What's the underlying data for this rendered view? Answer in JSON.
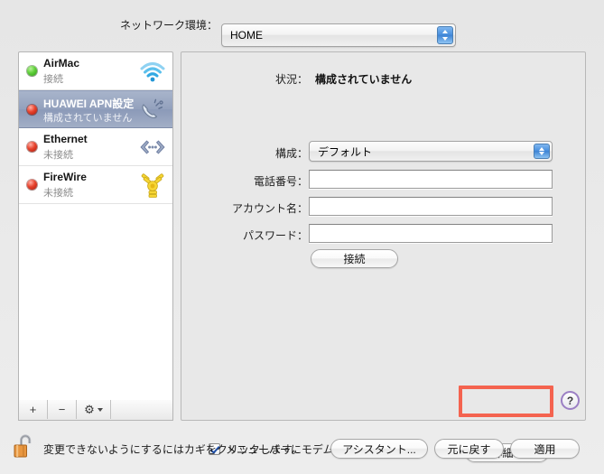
{
  "window": {
    "environment_label": "ネットワーク環境：",
    "environment_value": "HOME"
  },
  "sidebar": {
    "services": [
      {
        "name": "AirMac",
        "status": "接続",
        "icon": "wifi-icon",
        "led": "green",
        "selected": false
      },
      {
        "name": "HUAWEI APN設定",
        "status": "構成されていません",
        "icon": "modem-icon",
        "led": "red",
        "selected": true
      },
      {
        "name": "Ethernet",
        "status": "未接続",
        "icon": "ethernet-icon",
        "led": "red",
        "selected": false
      },
      {
        "name": "FireWire",
        "status": "未接続",
        "icon": "firewire-icon",
        "led": "red",
        "selected": false
      }
    ],
    "toolbar": {
      "add_label": "+",
      "remove_label": "−",
      "action_label": "⚙"
    }
  },
  "main": {
    "status_label": "状況：",
    "status_value": "構成されていません",
    "config_label": "構成：",
    "config_value": "デフォルト",
    "phone_label": "電話番号：",
    "phone_value": "",
    "account_label": "アカウント名：",
    "account_value": "",
    "password_label": "パスワード：",
    "password_value": "",
    "connect_label": "接続",
    "show_modem_checkbox_label": "メニューバーにモデムの状況を表示",
    "advanced_label": "詳細...",
    "help_label": "?"
  },
  "bottom": {
    "lock_text": "変更できないようにするにはカギをクリックします。",
    "assistant_label": "アシスタント...",
    "revert_label": "元に戻す",
    "apply_label": "適用"
  },
  "colors": {
    "annotation": "#f4634f",
    "selection": "#93a1bd",
    "led_green": "#5fd03a",
    "led_red": "#e8442e"
  }
}
